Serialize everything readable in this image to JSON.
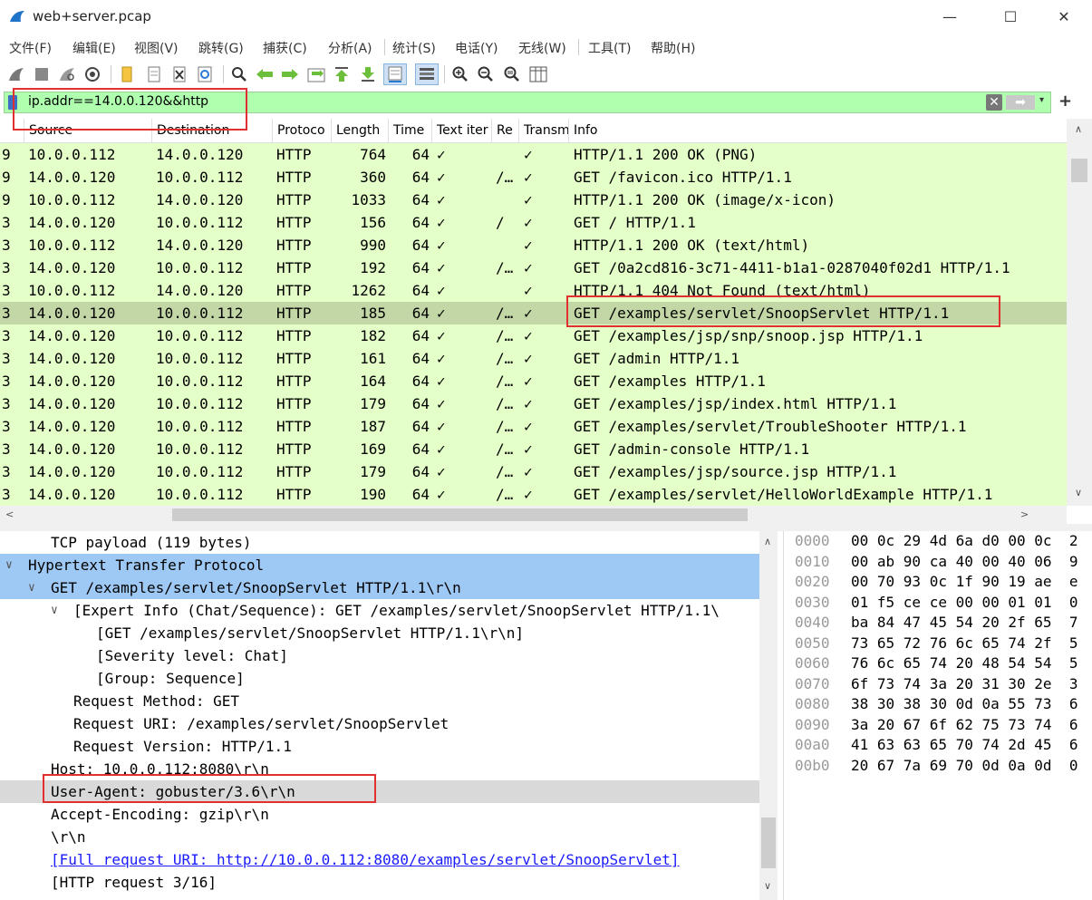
{
  "window": {
    "title": "web+server.pcap",
    "minimize": "—",
    "maximize": "☐",
    "close": "✕"
  },
  "menu": [
    "文件(F)",
    "编辑(E)",
    "视图(V)",
    "跳转(G)",
    "捕获(C)",
    "分析(A)",
    "统计(S)",
    "电话(Y)",
    "无线(W)",
    "工具(T)",
    "帮助(H)"
  ],
  "filter": {
    "value": "ip.addr==14.0.0.120&&http",
    "clear": "✕",
    "apply": "➡",
    "dropdown": "▾",
    "add": "+"
  },
  "columns": [
    "Source",
    "Destination",
    "Protoco",
    "Length",
    "Time",
    "Text iter",
    "Re",
    "Transm",
    "Info"
  ],
  "packets": [
    {
      "no": "9",
      "src": "10.0.0.112",
      "dst": "14.0.0.120",
      "proto": "HTTP",
      "len": "764",
      "ttl": "64",
      "text": "✓",
      "re": "",
      "tr": "✓",
      "info": "HTTP/1.1 200 OK  (PNG)"
    },
    {
      "no": "9",
      "src": "14.0.0.120",
      "dst": "10.0.0.112",
      "proto": "HTTP",
      "len": "360",
      "ttl": "64",
      "text": "✓",
      "re": "/…",
      "tr": "✓",
      "info": "GET /favicon.ico HTTP/1.1"
    },
    {
      "no": "9",
      "src": "10.0.0.112",
      "dst": "14.0.0.120",
      "proto": "HTTP",
      "len": "1033",
      "ttl": "64",
      "text": "✓",
      "re": "",
      "tr": "✓",
      "info": "HTTP/1.1 200 OK  (image/x-icon)"
    },
    {
      "no": "3",
      "src": "14.0.0.120",
      "dst": "10.0.0.112",
      "proto": "HTTP",
      "len": "156",
      "ttl": "64",
      "text": "✓",
      "re": "/",
      "tr": "✓",
      "info": "GET / HTTP/1.1"
    },
    {
      "no": "3",
      "src": "10.0.0.112",
      "dst": "14.0.0.120",
      "proto": "HTTP",
      "len": "990",
      "ttl": "64",
      "text": "✓",
      "re": "",
      "tr": "✓",
      "info": "HTTP/1.1 200 OK  (text/html)"
    },
    {
      "no": "3",
      "src": "14.0.0.120",
      "dst": "10.0.0.112",
      "proto": "HTTP",
      "len": "192",
      "ttl": "64",
      "text": "✓",
      "re": "/…",
      "tr": "✓",
      "info": "GET /0a2cd816-3c71-4411-b1a1-0287040f02d1 HTTP/1.1"
    },
    {
      "no": "3",
      "src": "10.0.0.112",
      "dst": "14.0.0.120",
      "proto": "HTTP",
      "len": "1262",
      "ttl": "64",
      "text": "✓",
      "re": "",
      "tr": "✓",
      "info": "HTTP/1.1 404 Not Found  (text/html)"
    },
    {
      "no": "3",
      "src": "14.0.0.120",
      "dst": "10.0.0.112",
      "proto": "HTTP",
      "len": "185",
      "ttl": "64",
      "text": "✓",
      "re": "/…",
      "tr": "✓",
      "info": "GET /examples/servlet/SnoopServlet HTTP/1.1",
      "selected": true
    },
    {
      "no": "3",
      "src": "14.0.0.120",
      "dst": "10.0.0.112",
      "proto": "HTTP",
      "len": "182",
      "ttl": "64",
      "text": "✓",
      "re": "/…",
      "tr": "✓",
      "info": "GET /examples/jsp/snp/snoop.jsp HTTP/1.1"
    },
    {
      "no": "3",
      "src": "14.0.0.120",
      "dst": "10.0.0.112",
      "proto": "HTTP",
      "len": "161",
      "ttl": "64",
      "text": "✓",
      "re": "/…",
      "tr": "✓",
      "info": "GET /admin HTTP/1.1"
    },
    {
      "no": "3",
      "src": "14.0.0.120",
      "dst": "10.0.0.112",
      "proto": "HTTP",
      "len": "164",
      "ttl": "64",
      "text": "✓",
      "re": "/…",
      "tr": "✓",
      "info": "GET /examples HTTP/1.1"
    },
    {
      "no": "3",
      "src": "14.0.0.120",
      "dst": "10.0.0.112",
      "proto": "HTTP",
      "len": "179",
      "ttl": "64",
      "text": "✓",
      "re": "/…",
      "tr": "✓",
      "info": "GET /examples/jsp/index.html HTTP/1.1"
    },
    {
      "no": "3",
      "src": "14.0.0.120",
      "dst": "10.0.0.112",
      "proto": "HTTP",
      "len": "187",
      "ttl": "64",
      "text": "✓",
      "re": "/…",
      "tr": "✓",
      "info": "GET /examples/servlet/TroubleShooter HTTP/1.1"
    },
    {
      "no": "3",
      "src": "14.0.0.120",
      "dst": "10.0.0.112",
      "proto": "HTTP",
      "len": "169",
      "ttl": "64",
      "text": "✓",
      "re": "/…",
      "tr": "✓",
      "info": "GET /admin-console HTTP/1.1"
    },
    {
      "no": "3",
      "src": "14.0.0.120",
      "dst": "10.0.0.112",
      "proto": "HTTP",
      "len": "179",
      "ttl": "64",
      "text": "✓",
      "re": "/…",
      "tr": "✓",
      "info": "GET /examples/jsp/source.jsp HTTP/1.1"
    },
    {
      "no": "3",
      "src": "14.0.0.120",
      "dst": "10.0.0.112",
      "proto": "HTTP",
      "len": "190",
      "ttl": "64",
      "text": "✓",
      "re": "/…",
      "tr": "✓",
      "info": "GET /examples/servlet/HelloWorldExample HTTP/1.1"
    }
  ],
  "details": [
    {
      "indent": 2,
      "toggle": "",
      "text": "TCP payload (119 bytes)",
      "style": ""
    },
    {
      "indent": 1,
      "toggle": "∨",
      "text": "Hypertext Transfer Protocol",
      "style": "hl"
    },
    {
      "indent": 2,
      "toggle": "∨",
      "text": "GET /examples/servlet/SnoopServlet HTTP/1.1\\r\\n",
      "style": "hl"
    },
    {
      "indent": 3,
      "toggle": "∨",
      "text": "[Expert Info (Chat/Sequence): GET /examples/servlet/SnoopServlet HTTP/1.1\\",
      "style": ""
    },
    {
      "indent": 4,
      "toggle": "",
      "text": "[GET /examples/servlet/SnoopServlet HTTP/1.1\\r\\n]",
      "style": ""
    },
    {
      "indent": 4,
      "toggle": "",
      "text": "[Severity level: Chat]",
      "style": ""
    },
    {
      "indent": 4,
      "toggle": "",
      "text": "[Group: Sequence]",
      "style": ""
    },
    {
      "indent": 3,
      "toggle": "",
      "text": "Request Method: GET",
      "style": ""
    },
    {
      "indent": 3,
      "toggle": "",
      "text": "Request URI: /examples/servlet/SnoopServlet",
      "style": ""
    },
    {
      "indent": 3,
      "toggle": "",
      "text": "Request Version: HTTP/1.1",
      "style": ""
    },
    {
      "indent": 2,
      "toggle": "",
      "text": "Host: 10.0.0.112:8080\\r\\n",
      "style": ""
    },
    {
      "indent": 2,
      "toggle": "",
      "text": "User-Agent: gobuster/3.6\\r\\n",
      "style": "gray"
    },
    {
      "indent": 2,
      "toggle": "",
      "text": "Accept-Encoding: gzip\\r\\n",
      "style": ""
    },
    {
      "indent": 2,
      "toggle": "",
      "text": "\\r\\n",
      "style": ""
    },
    {
      "indent": 2,
      "toggle": "",
      "text": "[Full request URI: http://10.0.0.112:8080/examples/servlet/SnoopServlet]",
      "style": "link"
    },
    {
      "indent": 2,
      "toggle": "",
      "text": "[HTTP request 3/16]",
      "style": ""
    }
  ],
  "hex": [
    {
      "off": "0000",
      "bytes": "00 0c 29 4d 6a d0 00 0c  2"
    },
    {
      "off": "0010",
      "bytes": "00 ab 90 ca 40 00 40 06  9"
    },
    {
      "off": "0020",
      "bytes": "00 70 93 0c 1f 90 19 ae  e"
    },
    {
      "off": "0030",
      "bytes": "01 f5 ce ce 00 00 01 01  0"
    },
    {
      "off": "0040",
      "bytes": "ba 84 47 45 54 20 2f 65  7"
    },
    {
      "off": "0050",
      "bytes": "73 65 72 76 6c 65 74 2f  5"
    },
    {
      "off": "0060",
      "bytes": "76 6c 65 74 20 48 54 54  5"
    },
    {
      "off": "0070",
      "bytes": "6f 73 74 3a 20 31 30 2e  3"
    },
    {
      "off": "0080",
      "bytes": "38 30 38 30 0d 0a 55 73  6"
    },
    {
      "off": "0090",
      "bytes": "3a 20 67 6f 62 75 73 74  6"
    },
    {
      "off": "00a0",
      "bytes": "41 63 63 65 70 74 2d 45  6"
    },
    {
      "off": "00b0",
      "bytes": "20 67 7a 69 70 0d 0a 0d  0"
    }
  ],
  "toolbar_icons": [
    "shark-fin-start-icon",
    "stop-icon",
    "restart-icon",
    "capture-options-icon",
    "open-file-icon",
    "file-icon",
    "close-file-icon",
    "reload-icon",
    "find-icon",
    "back-arrow-icon",
    "forward-arrow-icon",
    "goto-packet-icon",
    "first-packet-icon",
    "last-packet-icon",
    "autoscroll-icon",
    "colorize-icon",
    "zoom-in-icon",
    "zoom-out-icon",
    "zoom-normal-icon",
    "resize-columns-icon"
  ],
  "colors": {
    "filter_bg": "#afffaf",
    "row_bg": "#e4ffc7",
    "row_selected": "#c2d6a6",
    "detail_highlight": "#9ec9f5",
    "annotation": "#e03030"
  }
}
